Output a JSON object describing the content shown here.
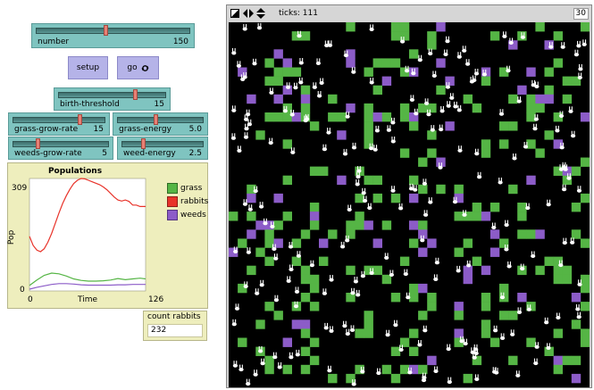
{
  "sliders": {
    "number": {
      "label": "number",
      "value": "150",
      "fraction": 0.45
    },
    "birth_threshold": {
      "label": "birth-threshold",
      "value": "15",
      "fraction": 0.72
    },
    "grass_grow_rate": {
      "label": "grass-grow-rate",
      "value": "15",
      "fraction": 0.74
    },
    "grass_energy": {
      "label": "grass-energy",
      "value": "5.0",
      "fraction": 0.45
    },
    "weeds_grow_rate": {
      "label": "weeds-grow-rate",
      "value": "5",
      "fraction": 0.25
    },
    "weed_energy": {
      "label": "weed-energy",
      "value": "2.5",
      "fraction": 0.25
    }
  },
  "buttons": {
    "setup": "setup",
    "go": "go"
  },
  "plot": {
    "title": "Populations",
    "ylabel": "Pop",
    "xlabel": "Time",
    "y_max_label": "309",
    "y_min_label": "0",
    "x_min_label": "0",
    "x_max_label": "126",
    "legend": [
      {
        "name": "grass",
        "color": "#55b545"
      },
      {
        "name": "rabbits",
        "color": "#e8332a"
      },
      {
        "name": "weeds",
        "color": "#8c5cc8"
      }
    ]
  },
  "chart_data": {
    "type": "line",
    "title": "Populations",
    "xlabel": "Time",
    "ylabel": "Pop",
    "xlim": [
      0,
      126
    ],
    "ylim": [
      0,
      309
    ],
    "series": [
      {
        "name": "rabbits",
        "color": "#e8332a",
        "x": [
          0,
          4,
          8,
          12,
          16,
          20,
          24,
          28,
          32,
          36,
          40,
          44,
          48,
          52,
          56,
          60,
          64,
          68,
          72,
          76,
          80,
          84,
          88,
          92,
          96,
          100,
          104,
          108,
          112,
          116,
          120,
          126
        ],
        "y": [
          150,
          125,
          112,
          108,
          116,
          134,
          158,
          186,
          214,
          240,
          262,
          280,
          295,
          304,
          309,
          308,
          304,
          300,
          296,
          292,
          286,
          278,
          268,
          258,
          250,
          247,
          250,
          246,
          236,
          236,
          232,
          232
        ]
      },
      {
        "name": "grass",
        "color": "#55b545",
        "x": [
          0,
          8,
          16,
          24,
          32,
          40,
          48,
          56,
          64,
          72,
          80,
          88,
          96,
          104,
          112,
          120,
          126
        ],
        "y": [
          15,
          30,
          43,
          49,
          47,
          41,
          33,
          29,
          27,
          27,
          28,
          30,
          34,
          31,
          33,
          35,
          33
        ]
      },
      {
        "name": "weeds",
        "color": "#8c5cc8",
        "x": [
          0,
          8,
          16,
          24,
          32,
          40,
          48,
          56,
          64,
          72,
          80,
          88,
          96,
          104,
          112,
          120,
          126
        ],
        "y": [
          5,
          10,
          14,
          18,
          20,
          20,
          19,
          17,
          16,
          16,
          16,
          16,
          17,
          17,
          18,
          18,
          18
        ]
      }
    ]
  },
  "monitor": {
    "label": "count rabbits",
    "value": "232"
  },
  "view": {
    "ticks": "ticks: 111",
    "speed": "30",
    "background": "#000000"
  },
  "colors": {
    "grass_patch": "#55b545",
    "weed_patch": "#8c5cc8",
    "rabbit": "#ffffff"
  }
}
